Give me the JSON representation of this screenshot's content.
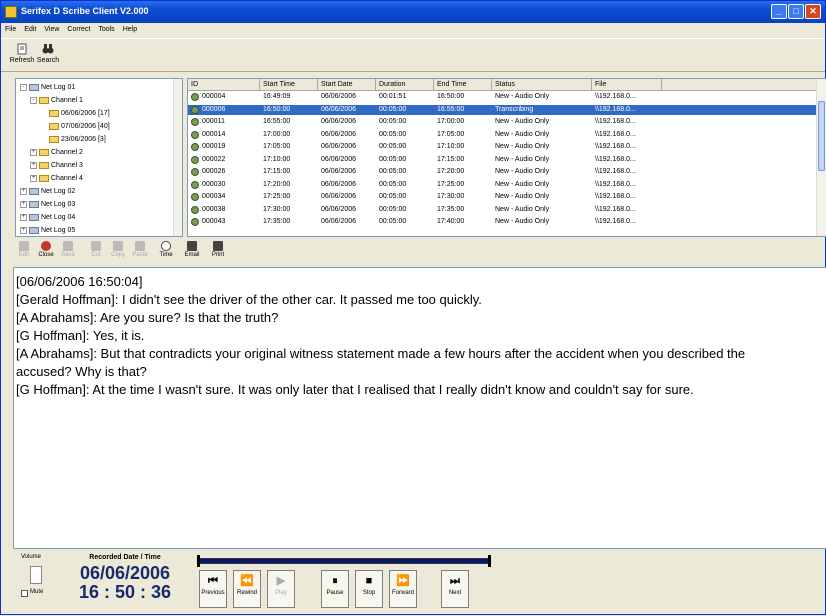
{
  "window": {
    "title": "Serifex D Scribe Client V2.000"
  },
  "menu": [
    "File",
    "Edit",
    "View",
    "Correct",
    "Tools",
    "Help"
  ],
  "toolbar": {
    "refresh_label": "Refresh",
    "search_label": "Search"
  },
  "tree": {
    "items": [
      {
        "label": "Net Log 01",
        "level": 0,
        "type": "drive",
        "expander": "-"
      },
      {
        "label": "Channel 1",
        "level": 1,
        "type": "folder",
        "expander": "-"
      },
      {
        "label": "06/06/2006 [17]",
        "level": 2,
        "type": "folder",
        "expander": ""
      },
      {
        "label": "07/06/2006 [40]",
        "level": 2,
        "type": "folder",
        "expander": ""
      },
      {
        "label": "23/06/2006 [3]",
        "level": 2,
        "type": "folder",
        "expander": ""
      },
      {
        "label": "Channel 2",
        "level": 1,
        "type": "folder",
        "expander": "+"
      },
      {
        "label": "Channel 3",
        "level": 1,
        "type": "folder",
        "expander": "+"
      },
      {
        "label": "Channel 4",
        "level": 1,
        "type": "folder",
        "expander": "+"
      },
      {
        "label": "Net Log 02",
        "level": 0,
        "type": "drive",
        "expander": "+"
      },
      {
        "label": "Net Log 03",
        "level": 0,
        "type": "drive",
        "expander": "+"
      },
      {
        "label": "Net Log 04",
        "level": 0,
        "type": "drive",
        "expander": "+"
      },
      {
        "label": "Net Log 05",
        "level": 0,
        "type": "drive",
        "expander": "+"
      }
    ]
  },
  "grid": {
    "columns": [
      "ID",
      "Start Time",
      "Start Date",
      "Duration",
      "End Time",
      "Status",
      "File"
    ],
    "rows": [
      {
        "id": "000004",
        "start_time": "16:49:09",
        "start_date": "06/06/2006",
        "duration": "00:01:51",
        "end_time": "16:50:00",
        "status": "New - Audio Only",
        "file": "\\\\192.168.0...",
        "selected": false
      },
      {
        "id": "000006",
        "start_time": "16:50:00",
        "start_date": "06/06/2006",
        "duration": "00:05:00",
        "end_time": "16:55:00",
        "status": "Transcribing",
        "file": "\\\\192.168.0...",
        "selected": true
      },
      {
        "id": "000011",
        "start_time": "16:55:00",
        "start_date": "06/06/2006",
        "duration": "00:05:00",
        "end_time": "17:00:00",
        "status": "New - Audio Only",
        "file": "\\\\192.168.0...",
        "selected": false
      },
      {
        "id": "000014",
        "start_time": "17:00:00",
        "start_date": "06/06/2006",
        "duration": "00:05:00",
        "end_time": "17:05:00",
        "status": "New - Audio Only",
        "file": "\\\\192.168.0...",
        "selected": false
      },
      {
        "id": "000019",
        "start_time": "17:05:00",
        "start_date": "06/06/2006",
        "duration": "00:05:00",
        "end_time": "17:10:00",
        "status": "New - Audio Only",
        "file": "\\\\192.168.0...",
        "selected": false
      },
      {
        "id": "000022",
        "start_time": "17:10:00",
        "start_date": "06/06/2006",
        "duration": "00:05:00",
        "end_time": "17:15:00",
        "status": "New - Audio Only",
        "file": "\\\\192.168.0...",
        "selected": false
      },
      {
        "id": "000026",
        "start_time": "17:15:00",
        "start_date": "06/06/2006",
        "duration": "00:05:00",
        "end_time": "17:20:00",
        "status": "New - Audio Only",
        "file": "\\\\192.168.0...",
        "selected": false
      },
      {
        "id": "000030",
        "start_time": "17:20:00",
        "start_date": "06/06/2006",
        "duration": "00:05:00",
        "end_time": "17:25:00",
        "status": "New - Audio Only",
        "file": "\\\\192.168.0...",
        "selected": false
      },
      {
        "id": "000034",
        "start_time": "17:25:00",
        "start_date": "06/06/2006",
        "duration": "00:05:00",
        "end_time": "17:30:00",
        "status": "New - Audio Only",
        "file": "\\\\192.168.0...",
        "selected": false
      },
      {
        "id": "000038",
        "start_time": "17:30:00",
        "start_date": "06/06/2006",
        "duration": "00:05:00",
        "end_time": "17:35:00",
        "status": "New - Audio Only",
        "file": "\\\\192.168.0...",
        "selected": false
      },
      {
        "id": "000043",
        "start_time": "17:35:00",
        "start_date": "06/06/2006",
        "duration": "00:05:00",
        "end_time": "17:40:00",
        "status": "New - Audio Only",
        "file": "\\\\192.168.0...",
        "selected": false
      }
    ]
  },
  "audio_toolbar": [
    {
      "label": "Edit",
      "icon": "edit-icon",
      "enabled": false
    },
    {
      "label": "Close",
      "icon": "close-record-icon",
      "enabled": true
    },
    {
      "label": "Save",
      "icon": "save-icon",
      "enabled": false
    },
    {
      "label": "Cut",
      "icon": "cut-icon",
      "enabled": false
    },
    {
      "label": "Copy",
      "icon": "copy-icon",
      "enabled": false
    },
    {
      "label": "Paste",
      "icon": "paste-icon",
      "enabled": false
    },
    {
      "label": "Time",
      "icon": "clock-icon",
      "enabled": true
    },
    {
      "label": "Email",
      "icon": "email-icon",
      "enabled": true
    },
    {
      "label": "Print",
      "icon": "printer-icon",
      "enabled": true
    }
  ],
  "transcript": {
    "lines": [
      "[06/06/2006  16:50:04]",
      "[Gerald Hoffman]: I didn't see the driver of the other car.  It passed me too quickly.",
      "[A Abrahams]: Are you sure? Is that the truth?",
      "[G Hoffman]: Yes, it is.",
      "[A Abrahams]: But that contradicts your original witness statement made a few hours after the accident when you described the accused? Why is that?",
      "[G Hoffman]: At the time I wasn't sure. It was only later that I realised that I really didn't know and couldn't say for sure."
    ]
  },
  "player": {
    "volume_label": "Volume",
    "mute_label": "Mute",
    "recorded_label": "Recorded Date / Time",
    "date": "06/06/2006",
    "time": "16 : 50 : 36",
    "buttons": [
      {
        "label": "Previous",
        "icon": "previous-icon",
        "glyph": "⏮",
        "enabled": true
      },
      {
        "label": "Rewind",
        "icon": "rewind-icon",
        "glyph": "⏪",
        "enabled": true
      },
      {
        "label": "Play",
        "icon": "play-icon",
        "glyph": "▶",
        "enabled": false
      },
      {
        "label": "Pause",
        "icon": "pause-icon",
        "glyph": "⏸",
        "enabled": true
      },
      {
        "label": "Stop",
        "icon": "stop-icon",
        "glyph": "■",
        "enabled": true
      },
      {
        "label": "Forward",
        "icon": "forward-icon",
        "glyph": "⏩",
        "enabled": true
      },
      {
        "label": "Next",
        "icon": "next-icon",
        "glyph": "⏭",
        "enabled": true
      }
    ]
  },
  "colors": {
    "selection": "#316ac5",
    "title_bar": "#0a4bd4",
    "datetime_text": "#1a2a6c"
  }
}
